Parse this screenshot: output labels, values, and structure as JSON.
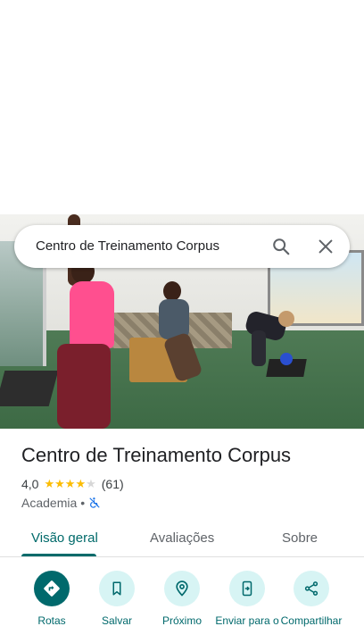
{
  "search": {
    "query": "Centro de Treinamento Corpus",
    "search_icon": "search-icon",
    "close_icon": "close-icon"
  },
  "place": {
    "title": "Centro de Treinamento Corpus",
    "rating": "4,0",
    "stars_filled": 4,
    "stars_total": 5,
    "review_count": "(61)",
    "category": "Academia",
    "separator": "•",
    "accessibility_icon": "wheelchair-not-accessible-icon"
  },
  "tabs": [
    {
      "label": "Visão geral",
      "active": true
    },
    {
      "label": "Avaliações",
      "active": false
    },
    {
      "label": "Sobre",
      "active": false
    }
  ],
  "actions": [
    {
      "label": "Rotas",
      "icon": "directions-icon"
    },
    {
      "label": "Salvar",
      "icon": "bookmark-icon"
    },
    {
      "label": "Próximo",
      "icon": "nearby-icon"
    },
    {
      "label": "Enviar para o",
      "icon": "send-to-phone-icon"
    },
    {
      "label": "Compartilhar",
      "icon": "share-icon"
    }
  ],
  "colors": {
    "accent": "#00696c",
    "star": "#fbbc04",
    "pink_top": "#ff4f8f",
    "floor": "#3d6a45"
  }
}
